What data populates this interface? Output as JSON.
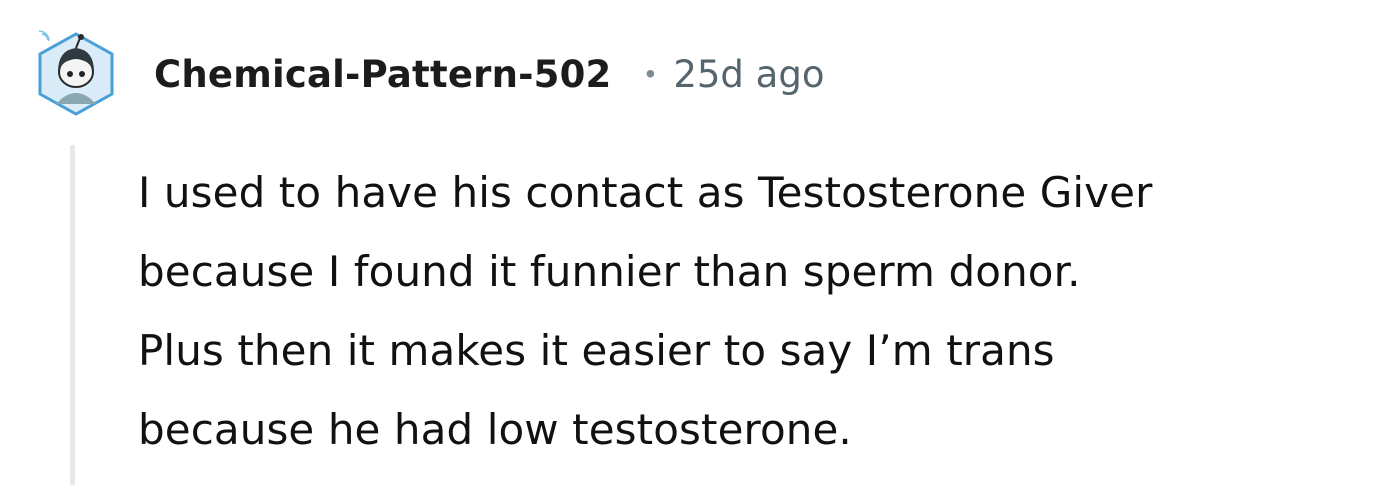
{
  "comment": {
    "author": "Chemical-Pattern-502",
    "separator": "•",
    "timestamp": "25d ago",
    "body_lines": [
      "I used to have his contact as Testosterone Giver",
      "because I found it funnier than sperm donor.",
      "Plus then it makes it easier to say I’m trans",
      "because he had low testosterone."
    ]
  },
  "icons": {
    "avatar": "snoo-avatar-hexagon"
  },
  "colors": {
    "username": "#1c1c1c",
    "timestamp": "#56656d",
    "body_text": "#111111",
    "thread_line": "#e5e8ea",
    "avatar_hex": "#4a9fd8"
  }
}
